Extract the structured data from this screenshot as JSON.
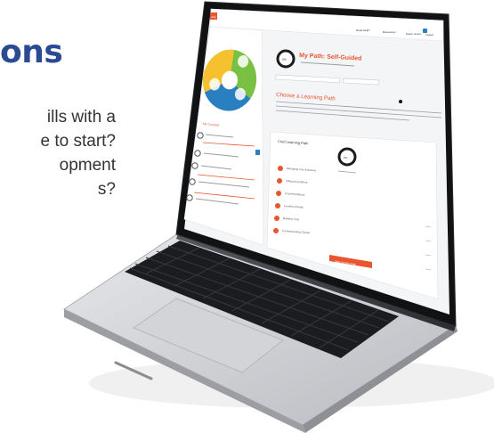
{
  "heading": "ons",
  "body_lines": [
    "ills with a",
    "e to start?",
    "opment",
    "s?"
  ],
  "screen": {
    "logo": "vital",
    "top_nav": [
      "Need Help?",
      "Resources",
      "Karen Jones",
      "Logout"
    ],
    "path_title": "My Path: Self-Guided",
    "progress_percent": "0%",
    "section_title": "Choose a Learning Path",
    "card_title": "Cmd Learning Path",
    "card_progress": "0%",
    "card_items": [
      "Managing Your Emotions",
      "Influencing Others",
      "Coaching Basics",
      "Leading Change",
      "Building Trust",
      "Communicating Clearly"
    ],
    "start_button": "Start Learning Path",
    "sidebar_heading": "My Courses",
    "sidebar_items": [
      "Course 1",
      "Course 2",
      "Course 3",
      "Course 4"
    ]
  },
  "colors": {
    "heading_blue": "#2a4a93",
    "accent_orange": "#e8552e",
    "wheel_green": "#7ac143",
    "wheel_yellow": "#f5c12e",
    "wheel_blue": "#2a7fc1"
  }
}
